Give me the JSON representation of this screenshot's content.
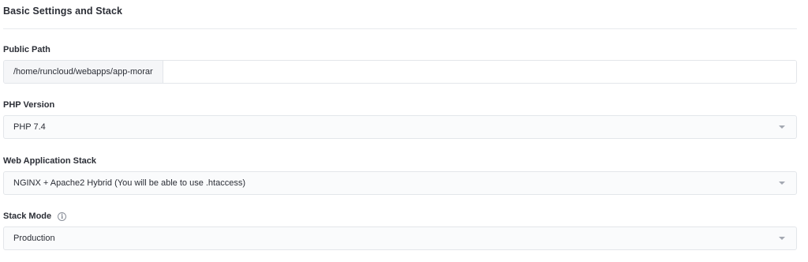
{
  "section": {
    "title": "Basic Settings and Stack"
  },
  "public_path": {
    "label": "Public Path",
    "prefix": "/home/runcloud/webapps/app-morar",
    "value": ""
  },
  "php_version": {
    "label": "PHP Version",
    "selected": "PHP 7.4"
  },
  "web_stack": {
    "label": "Web Application Stack",
    "selected": "NGINX + Apache2 Hybrid (You will be able to use .htaccess)"
  },
  "stack_mode": {
    "label": "Stack Mode",
    "info_icon_glyph": "i",
    "selected": "Production"
  },
  "icons": {
    "info": "info-circle-icon",
    "caret": "chevron-down-icon"
  }
}
